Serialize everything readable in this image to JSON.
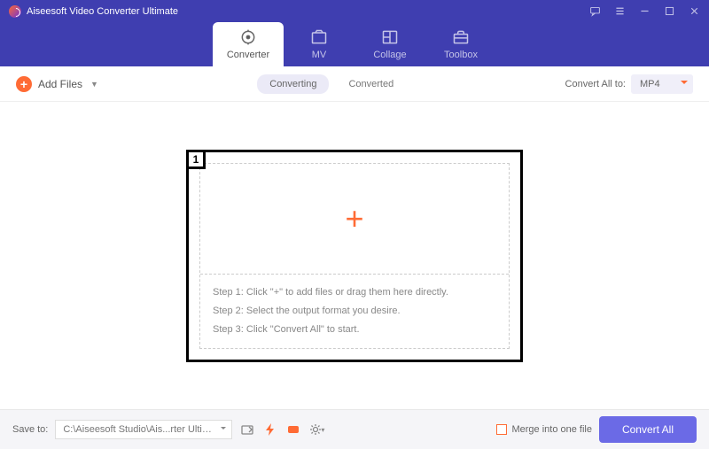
{
  "app": {
    "title": "Aiseesoft Video Converter Ultimate"
  },
  "tabs": [
    {
      "label": "Converter"
    },
    {
      "label": "MV"
    },
    {
      "label": "Collage"
    },
    {
      "label": "Toolbox"
    }
  ],
  "toolbar": {
    "add_files": "Add Files",
    "segments": [
      {
        "label": "Converting"
      },
      {
        "label": "Converted"
      }
    ],
    "convert_all_label": "Convert All to:",
    "format": "MP4"
  },
  "drop": {
    "badge": "1",
    "steps": [
      "Step 1: Click \"+\" to add files or drag them here directly.",
      "Step 2: Select the output format you desire.",
      "Step 3: Click \"Convert All\" to start."
    ]
  },
  "footer": {
    "save_to_label": "Save to:",
    "path": "C:\\Aiseesoft Studio\\Ais...rter Ultimate\\Converted",
    "merge_label": "Merge into one file",
    "convert_btn": "Convert All"
  }
}
